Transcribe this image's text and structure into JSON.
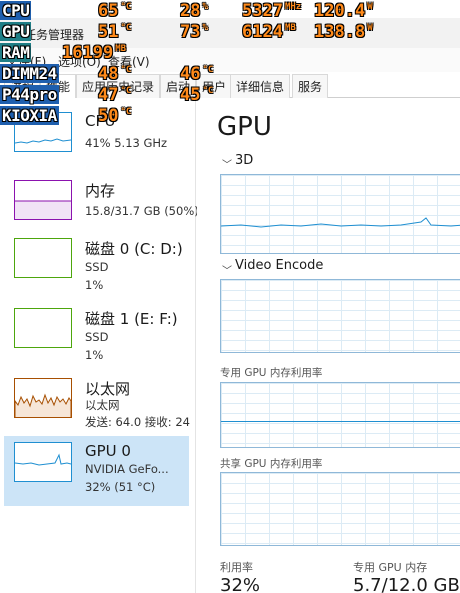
{
  "window": {
    "title": "任务管理器"
  },
  "menu": {
    "file": "文件(F)",
    "options": "选项(O)",
    "view": "查看(V)"
  },
  "tabs": [
    "进程",
    "性能",
    "应用历史记录",
    "启动",
    "用户",
    "详细信息",
    "服务"
  ],
  "resources": [
    {
      "name": "CPU",
      "sub1": "41% 5.13 GHz",
      "sub2": "",
      "color": "#1f8fd1"
    },
    {
      "name": "内存",
      "sub1": "15.8/31.7 GB (50%)",
      "sub2": "",
      "color": "#8b12ae"
    },
    {
      "name": "磁盘 0 (C: D:)",
      "sub1": "SSD",
      "sub2": "1%",
      "color": "#4da60c"
    },
    {
      "name": "磁盘 1 (E: F:)",
      "sub1": "SSD",
      "sub2": "1%",
      "color": "#4da60c"
    },
    {
      "name": "以太网",
      "sub1": "以太网",
      "sub2": "发送: 64.0  接收: 24",
      "color": "#a74f01"
    },
    {
      "name": "GPU 0",
      "sub1": "NVIDIA GeFo...",
      "sub2": "32% (51 °C)",
      "color": "#1f8fd1"
    }
  ],
  "detail": {
    "title": "GPU",
    "engine1": "3D",
    "engine2": "Video Encode",
    "dedicated_label": "专用 GPU 内存利用率",
    "shared_label": "共享 GPU 内存利用率",
    "util_label": "利用率",
    "util_value": "32%",
    "mem_label": "专用 GPU 内存",
    "mem_value": "5.7/12.0 GB"
  },
  "osd": [
    {
      "label": "CPU",
      "style": "blue",
      "values": [
        [
          "65",
          "°C"
        ],
        [
          "28",
          "%"
        ],
        [
          "5327",
          "MHz"
        ],
        [
          "120.4",
          "W"
        ]
      ]
    },
    {
      "label": "GPU",
      "style": "teal",
      "values": [
        [
          "51",
          "°C"
        ],
        [
          "73",
          "%"
        ],
        [
          "6124",
          "MB"
        ],
        [
          "138.8",
          "W"
        ]
      ]
    },
    {
      "label": "RAM",
      "style": "teal",
      "values": [
        [
          "16199",
          "MB"
        ]
      ]
    },
    {
      "label": "DIMM24",
      "style": "blue",
      "values": [
        [
          "48",
          "°C"
        ],
        [
          "46",
          "°C"
        ]
      ]
    },
    {
      "label": "P44pro",
      "style": "blue",
      "values": [
        [
          "47",
          "°C"
        ],
        [
          "45",
          "°C"
        ]
      ]
    },
    {
      "label": "KIOXIA",
      "style": "blue",
      "values": [
        [
          "50",
          "°C"
        ]
      ]
    }
  ]
}
